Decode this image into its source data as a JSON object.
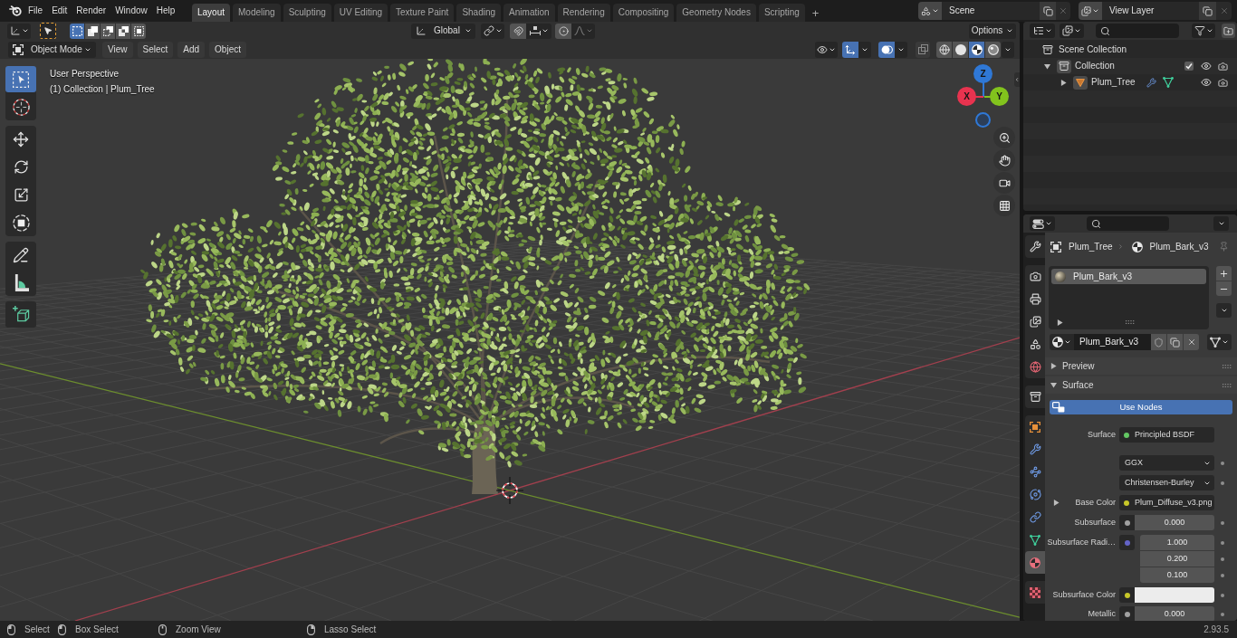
{
  "topbar": {
    "menus": [
      "File",
      "Edit",
      "Render",
      "Window",
      "Help"
    ],
    "workspaces": [
      {
        "label": "Layout",
        "selected": true
      },
      {
        "label": "Modeling",
        "selected": false
      },
      {
        "label": "Sculpting",
        "selected": false
      },
      {
        "label": "UV Editing",
        "selected": false
      },
      {
        "label": "Texture Paint",
        "selected": false
      },
      {
        "label": "Shading",
        "selected": false
      },
      {
        "label": "Animation",
        "selected": false
      },
      {
        "label": "Rendering",
        "selected": false
      },
      {
        "label": "Compositing",
        "selected": false
      },
      {
        "label": "Geometry Nodes",
        "selected": false
      },
      {
        "label": "Scripting",
        "selected": false
      }
    ],
    "add_workspace": "+",
    "scene": "Scene",
    "view_layer": "View Layer"
  },
  "viewport": {
    "tool_settings": {
      "select_modes": [
        {
          "kind": "set",
          "selected": true
        },
        {
          "kind": "extend",
          "selected": false
        },
        {
          "kind": "subtract",
          "selected": false
        },
        {
          "kind": "difference",
          "selected": false
        },
        {
          "kind": "intersect",
          "selected": false
        }
      ],
      "orientation": "Global",
      "snap": false,
      "proportional": false,
      "options": "Options"
    },
    "header": {
      "mode": "Object Mode",
      "menus": [
        "View",
        "Select",
        "Add",
        "Object"
      ],
      "gizmos": true,
      "overlays": true,
      "xray": false,
      "shading": [
        {
          "kind": "wireframe",
          "selected": false
        },
        {
          "kind": "solid",
          "selected": false
        },
        {
          "kind": "material",
          "selected": true
        },
        {
          "kind": "rendered",
          "selected": false
        }
      ]
    },
    "toolbar": [
      [
        {
          "kind": "select_box",
          "selected": true
        },
        {
          "kind": "cursor",
          "selected": false
        }
      ],
      [
        {
          "kind": "move",
          "selected": false
        },
        {
          "kind": "rotate",
          "selected": false
        },
        {
          "kind": "scale",
          "selected": false
        },
        {
          "kind": "transform",
          "selected": false
        }
      ],
      [
        {
          "kind": "annotate",
          "selected": false
        },
        {
          "kind": "measure",
          "selected": false
        }
      ],
      [
        {
          "kind": "add_cube",
          "selected": false
        }
      ]
    ],
    "view_name": "User Perspective",
    "view_info": "(1) Collection | Plum_Tree",
    "gizmo": [
      {
        "kind": "z",
        "label": "Z",
        "color": "#2f78d6"
      },
      {
        "kind": "x",
        "label": "X",
        "color": "#e8334f"
      },
      {
        "kind": "y",
        "label": "Y",
        "color": "#82c31d"
      }
    ]
  },
  "outliner": {
    "tree": [
      {
        "label": "Scene Collection",
        "kind": "scene_collection",
        "active": false,
        "children": [
          {
            "label": "Collection",
            "kind": "collection",
            "active": true,
            "expanded": true,
            "checked": true,
            "children": [
              {
                "label": "Plum_Tree",
                "kind": "object",
                "active": true,
                "expanded": false
              }
            ]
          }
        ]
      }
    ]
  },
  "properties": {
    "tabs": [
      [
        {
          "kind": "tool",
          "selected": false
        }
      ],
      [
        {
          "kind": "render",
          "selected": false
        },
        {
          "kind": "output",
          "selected": false
        },
        {
          "kind": "view_layer",
          "selected": false
        },
        {
          "kind": "scene",
          "selected": false
        },
        {
          "kind": "world",
          "selected": false
        }
      ],
      [
        {
          "kind": "collection",
          "selected": false
        }
      ],
      [
        {
          "kind": "object",
          "selected": false
        },
        {
          "kind": "modifiers",
          "selected": false
        },
        {
          "kind": "particles",
          "selected": false
        },
        {
          "kind": "physics",
          "selected": false
        },
        {
          "kind": "constraints",
          "selected": false
        },
        {
          "kind": "data",
          "selected": false
        },
        {
          "kind": "material",
          "selected": true
        }
      ],
      [
        {
          "kind": "texture",
          "selected": false
        }
      ]
    ],
    "breadcrumb": [
      {
        "kind": "object",
        "label": "Plum_Tree"
      },
      {
        "kind": "material",
        "label": "Plum_Bark_v3"
      }
    ],
    "material_slots": [
      {
        "label": "Plum_Bark_v3",
        "selected": true
      }
    ],
    "material": "Plum_Bark_v3",
    "panels": [
      {
        "title": "Preview",
        "expanded": false
      },
      {
        "title": "Surface",
        "expanded": true,
        "use_nodes": {
          "label": "Use Nodes",
          "on": true
        },
        "inputs": [
          {
            "kind": "link",
            "label": "Surface",
            "value": "Principled BSDF",
            "color": "#63c763"
          },
          {
            "kind": "menu",
            "value": "GGX"
          },
          {
            "kind": "menu",
            "value": "Christensen-Burley"
          },
          {
            "kind": "link",
            "label": "Base Color",
            "value": "Plum_Diffuse_v3.png",
            "color": "#c7c729",
            "expanded": false
          },
          {
            "kind": "number",
            "label": "Subsurface",
            "values": [
              "0.000"
            ],
            "color": "#a1a1a1"
          },
          {
            "kind": "number",
            "label": "Subsurface Radi…",
            "values": [
              "1.000",
              "0.200",
              "0.100"
            ],
            "color": "#6363c7"
          },
          {
            "kind": "swatch",
            "label": "Subsurface Color",
            "color": "#c7c729"
          },
          {
            "kind": "number",
            "label": "Metallic",
            "values": [
              "0.000"
            ],
            "color": "#a1a1a1"
          }
        ]
      }
    ]
  },
  "status_bar": {
    "hints": [
      {
        "kind": "click",
        "label": "Select"
      },
      {
        "kind": "drag",
        "label": "Box Select"
      },
      {
        "kind": "middle",
        "label": "Zoom View"
      },
      {
        "kind": "right_drag",
        "label": "Lasso Select"
      }
    ],
    "version": "2.93.5"
  }
}
